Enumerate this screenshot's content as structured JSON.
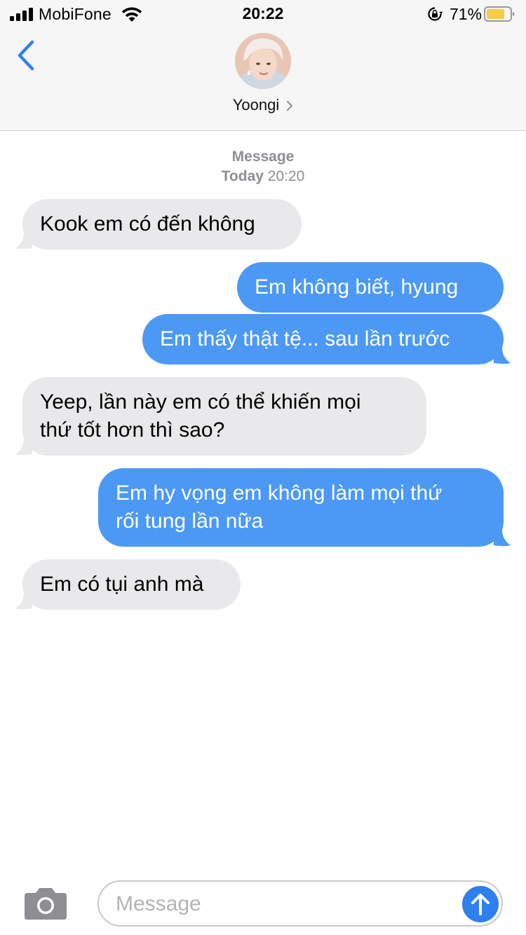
{
  "status_bar": {
    "carrier": "MobiFone",
    "time": "20:22",
    "battery_percent": "71%",
    "signal_bars": 3,
    "icons": [
      "signal-icon",
      "wifi-icon",
      "orientation-lock-icon",
      "battery-icon"
    ]
  },
  "nav": {
    "contact_name": "Yoongi",
    "icons": [
      "back-chevron-icon",
      "chevron-right-icon"
    ]
  },
  "conversation": {
    "timestamp_kind": "Message",
    "timestamp_day": "Today",
    "timestamp_time": "20:20",
    "messages": [
      {
        "direction": "incoming",
        "lines": [
          "Kook em có đến không"
        ]
      },
      {
        "direction": "outgoing",
        "lines": [
          "Em không biết, hyung"
        ]
      },
      {
        "direction": "outgoing",
        "lines": [
          "Em thấy thật tệ... sau lần trước"
        ]
      },
      {
        "direction": "incoming",
        "lines": [
          "Yeep, lần này em có thể khiến mọi",
          "thứ tốt hơn thì sao?"
        ]
      },
      {
        "direction": "outgoing",
        "lines": [
          "Em hy vọng em không làm mọi thứ",
          "rối tung lần nữa"
        ]
      },
      {
        "direction": "incoming",
        "lines": [
          "Em có tụi anh mà"
        ]
      }
    ]
  },
  "composer": {
    "placeholder": "Message",
    "value": "",
    "icons": [
      "camera-icon",
      "send-arrow-icon"
    ]
  },
  "colors": {
    "incoming_bubble": "#e9e9eb",
    "outgoing_bubble": "#4c99f5",
    "accent": "#2f7ff0",
    "battery_fill": "#f6cc42"
  }
}
